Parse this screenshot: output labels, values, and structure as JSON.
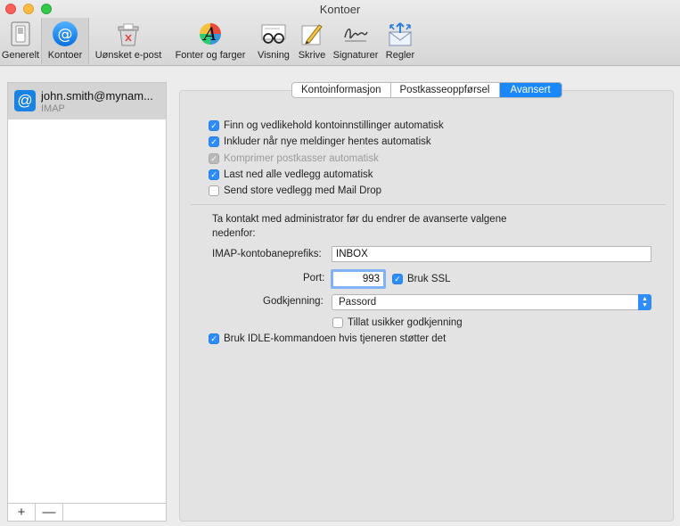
{
  "window": {
    "title": "Kontoer"
  },
  "toolbar": [
    {
      "label": "Generelt",
      "icon": "general-switch-icon"
    },
    {
      "label": "Kontoer",
      "icon": "at-sign-icon"
    },
    {
      "label": "Uønsket e-post",
      "icon": "junk-mail-bin-icon"
    },
    {
      "label": "Fonter og farger",
      "icon": "fonts-colors-icon"
    },
    {
      "label": "Visning",
      "icon": "glasses-letter-icon"
    },
    {
      "label": "Skrive",
      "icon": "pencil-paper-icon"
    },
    {
      "label": "Signaturer",
      "icon": "signature-icon"
    },
    {
      "label": "Regler",
      "icon": "rules-envelope-icon"
    }
  ],
  "sidebar": {
    "account": {
      "name": "john.smith@mynam...",
      "type": "IMAP",
      "icon": "at-sign-icon"
    },
    "add_label": "+",
    "remove_label": "—"
  },
  "tabs": [
    {
      "label": "Kontoinformasjon",
      "active": false
    },
    {
      "label": "Postkasseoppførsel",
      "active": false
    },
    {
      "label": "Avansert",
      "active": true
    }
  ],
  "options": [
    {
      "label": "Finn og vedlikehold kontoinnstillinger automatisk",
      "checked": true,
      "enabled": true
    },
    {
      "label": "Inkluder når nye meldinger hentes automatisk",
      "checked": true,
      "enabled": true
    },
    {
      "label": "Komprimer postkasser automatisk",
      "checked": true,
      "enabled": false
    },
    {
      "label": "Last ned alle vedlegg automatisk",
      "checked": true,
      "enabled": true
    },
    {
      "label": "Send store vedlegg med Mail Drop",
      "checked": false,
      "enabled": true
    }
  ],
  "notice": "Ta kontakt med administrator før du endrer de avanserte valgene nedenfor:",
  "imap_prefix": {
    "label": "IMAP-kontobaneprefiks:",
    "value": "INBOX"
  },
  "port": {
    "label": "Port:",
    "value": "993",
    "ssl_label": "Bruk SSL",
    "ssl_checked": true
  },
  "auth": {
    "label": "Godkjenning:",
    "value": "Passord",
    "insecure_label": "Tillat usikker godkjenning",
    "insecure_checked": false
  },
  "idle": {
    "label": "Bruk IDLE-kommandoen hvis tjeneren støtter det",
    "checked": true
  },
  "colors": {
    "accent": "#1b88f8",
    "checkbox": "#2f8dfa",
    "selection": "#d4d4d4"
  }
}
